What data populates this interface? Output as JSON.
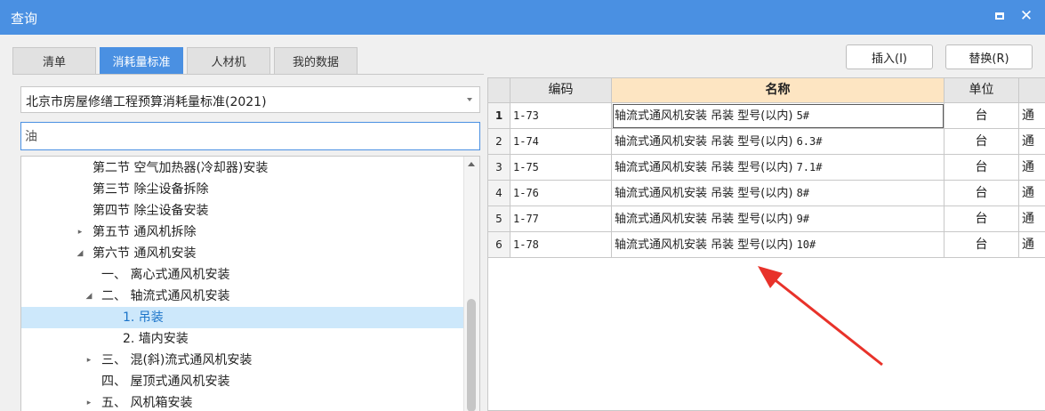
{
  "window": {
    "title": "查询"
  },
  "tabs": [
    {
      "label": "清单",
      "active": false
    },
    {
      "label": "消耗量标准",
      "active": true
    },
    {
      "label": "人材机",
      "active": false
    },
    {
      "label": "我的数据",
      "active": false
    }
  ],
  "toolbar": {
    "insert_label": "插入(I)",
    "replace_label": "替换(R)"
  },
  "standard_select": {
    "value": "北京市房屋修缮工程预算消耗量标准(2021)"
  },
  "search": {
    "value": "油"
  },
  "tree": [
    {
      "label": "第二节 空气加热器(冷却器)安装",
      "level": 0,
      "arrow": "",
      "selected": false
    },
    {
      "label": "第三节 除尘设备拆除",
      "level": 0,
      "arrow": "",
      "selected": false
    },
    {
      "label": "第四节 除尘设备安装",
      "level": 0,
      "arrow": "",
      "selected": false
    },
    {
      "label": "第五节 通风机拆除",
      "level": 0,
      "arrow": "▸",
      "selected": false
    },
    {
      "label": "第六节 通风机安装",
      "level": 0,
      "arrow": "◢",
      "selected": false
    },
    {
      "label": "一、 离心式通风机安装",
      "level": 1,
      "arrow": "",
      "selected": false
    },
    {
      "label": "二、 轴流式通风机安装",
      "level": 1,
      "arrow": "◢",
      "selected": false
    },
    {
      "label": "1. 吊装",
      "level": 2,
      "arrow": "",
      "selected": true
    },
    {
      "label": "2. 墙内安装",
      "level": 2,
      "arrow": "",
      "selected": false
    },
    {
      "label": "三、 混(斜)流式通风机安装",
      "level": 1,
      "arrow": "▸",
      "selected": false
    },
    {
      "label": "四、 屋顶式通风机安装",
      "level": 1,
      "arrow": "",
      "selected": false
    },
    {
      "label": "五、 风机箱安装",
      "level": 1,
      "arrow": "▸",
      "selected": false
    }
  ],
  "grid": {
    "columns": [
      "编码",
      "名称",
      "单位"
    ],
    "highlight_column": "名称",
    "rows": [
      {
        "num": "1",
        "code": "1-73",
        "name": "轴流式通风机安装 吊装 型号(以内)",
        "spec": "5#",
        "unit": "台",
        "extra": "通"
      },
      {
        "num": "2",
        "code": "1-74",
        "name": "轴流式通风机安装 吊装 型号(以内)",
        "spec": "6.3#",
        "unit": "台",
        "extra": "通"
      },
      {
        "num": "3",
        "code": "1-75",
        "name": "轴流式通风机安装 吊装 型号(以内)",
        "spec": "7.1#",
        "unit": "台",
        "extra": "通"
      },
      {
        "num": "4",
        "code": "1-76",
        "name": "轴流式通风机安装 吊装 型号(以内)",
        "spec": "8#",
        "unit": "台",
        "extra": "通"
      },
      {
        "num": "5",
        "code": "1-77",
        "name": "轴流式通风机安装 吊装 型号(以内)",
        "spec": "9#",
        "unit": "台",
        "extra": "通"
      },
      {
        "num": "6",
        "code": "1-78",
        "name": "轴流式通风机安装 吊装 型号(以内)",
        "spec": "10#",
        "unit": "台",
        "extra": "通"
      }
    ]
  },
  "colors": {
    "accent": "#4a90e2",
    "header_highlight": "#fde5c2",
    "selection": "#cde8fb",
    "annotation": "#e8322a"
  }
}
